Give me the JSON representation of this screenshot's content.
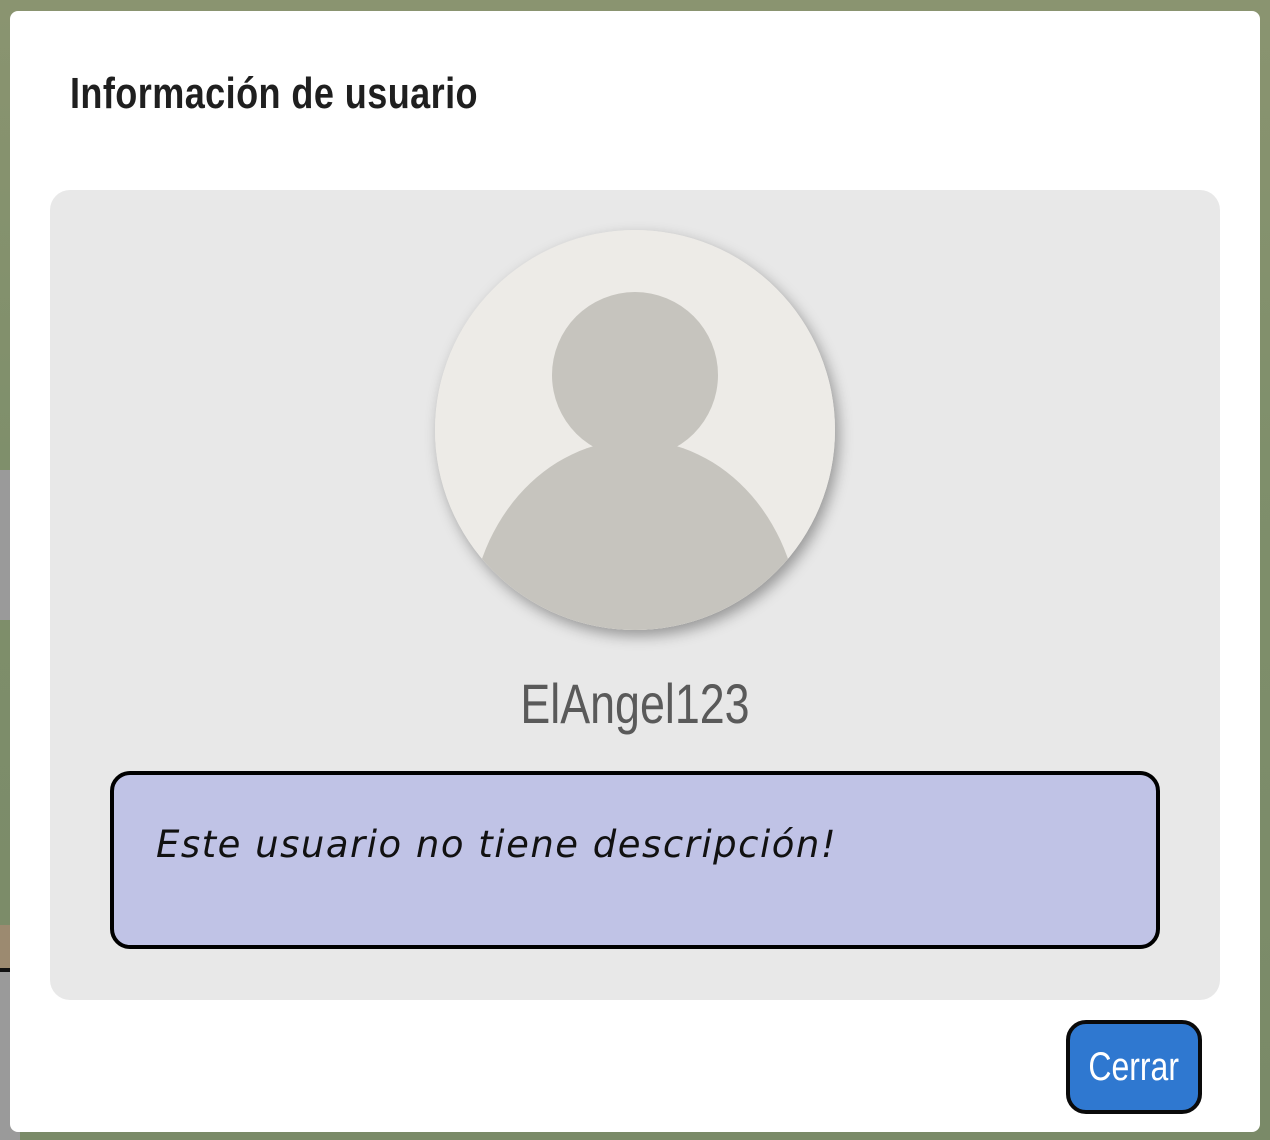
{
  "modal": {
    "title": "Información de usuario",
    "username": "ElAngel123",
    "description": "Este usuario no tiene descripción!",
    "close_label": "Cerrar"
  },
  "avatar": {
    "icon": "default-user-avatar-icon"
  },
  "colors": {
    "modal_background": "#ffffff",
    "card_background": "#e8e8e8",
    "description_background": "#c0c3e6",
    "button_background": "#2f78d0",
    "avatar_background": "#edebe7",
    "avatar_silhouette": "#c6c4be"
  }
}
